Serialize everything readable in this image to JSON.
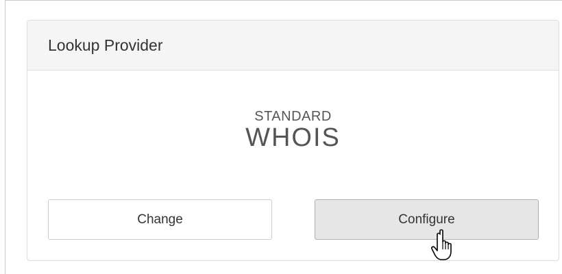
{
  "panel": {
    "title": "Lookup Provider"
  },
  "logo": {
    "line1": "STANDARD",
    "line2": "WHOIS"
  },
  "buttons": {
    "change_label": "Change",
    "configure_label": "Configure"
  },
  "cursor": {
    "icon": "hand-pointer-icon"
  }
}
